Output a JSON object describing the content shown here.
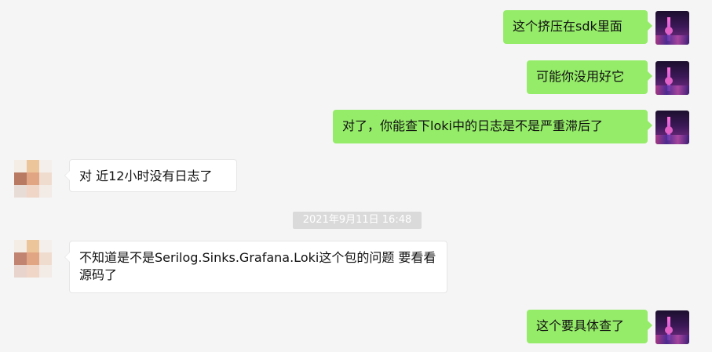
{
  "chat": {
    "messages": [
      {
        "text": "这个挤压在sdk里面",
        "side": "out"
      },
      {
        "text": "可能你没用好它",
        "side": "out"
      },
      {
        "text": "对了，你能查下loki中的日志是不是严重滞后了",
        "side": "out"
      },
      {
        "text": "对 近12小时没有日志了",
        "side": "in"
      },
      {
        "text": "不知道是不是Serilog.Sinks.Grafana.Loki这个包的问题 要看看源码了",
        "side": "in"
      },
      {
        "text": "这个要具体查了",
        "side": "out"
      }
    ],
    "timestamp": "2021年9月11日 16:48"
  },
  "colors": {
    "outgoing_bubble": "#95ec69",
    "incoming_bubble": "#ffffff",
    "background": "#f5f5f5",
    "timestamp_bg": "#dadada"
  }
}
